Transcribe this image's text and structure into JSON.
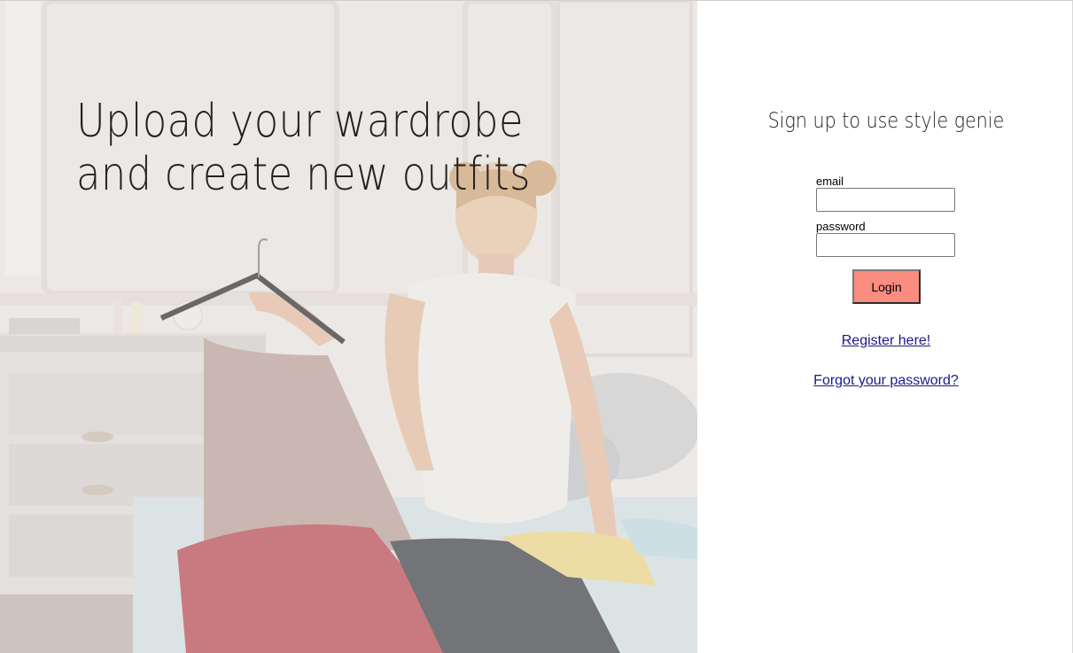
{
  "hero": {
    "title": "Upload your wardrobe and create new outfits"
  },
  "signup": {
    "heading": "Sign up to use style genie",
    "email_label": "email",
    "email_value": "",
    "password_label": "password",
    "password_value": "",
    "login_label": "Login",
    "register_link": "Register here!",
    "forgot_link": "Forgot your password?"
  },
  "colors": {
    "login_button": "#fa8c80",
    "link": "#1a1a8c",
    "hero_title": "#26211f"
  }
}
